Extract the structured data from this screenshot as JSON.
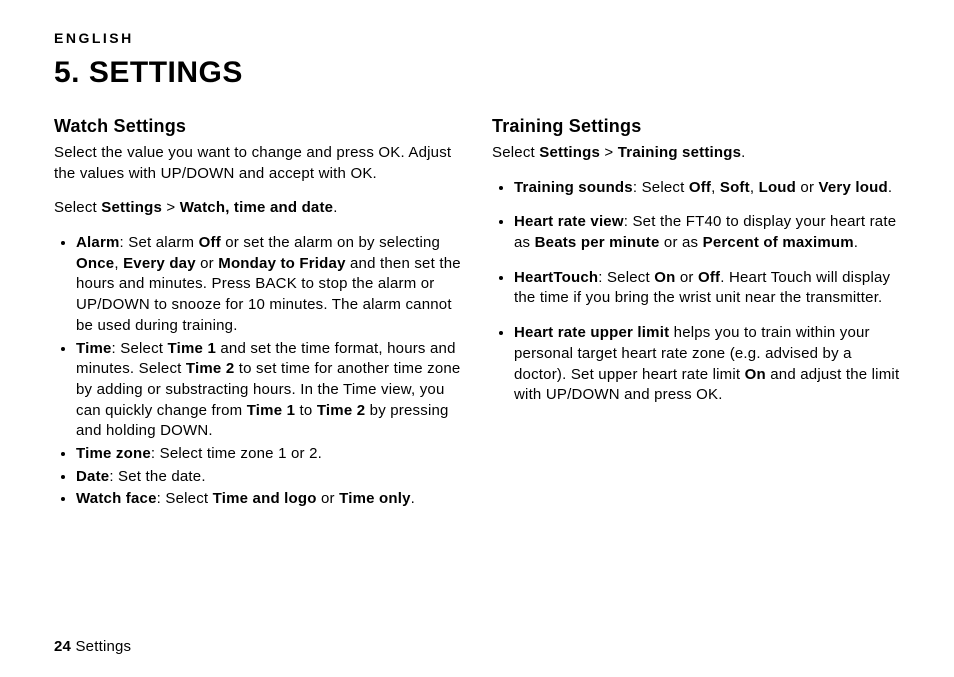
{
  "header": {
    "language": "ENGLISH",
    "title": "5. SETTINGS"
  },
  "watch": {
    "heading": "Watch Settings",
    "intro": "Select the value you want to change and press OK. Adjust the values with UP/DOWN and accept with OK.",
    "select_pre": "Select ",
    "select_path_a": "Settings",
    "select_gt": " > ",
    "select_path_b": "Watch, time and date",
    "select_post": ".",
    "alarm": {
      "label": "Alarm",
      "t1": ": Set alarm ",
      "off": "Off",
      "t2": " or set the alarm on by selecting ",
      "once": "Once",
      "t3": ", ",
      "everyday": "Every day",
      "t4": " or ",
      "mon_fri": "Monday to Friday",
      "t5": " and then set the hours and minutes. Press BACK to stop the alarm or UP/DOWN to snooze for 10 minutes. The alarm cannot be used during training."
    },
    "time": {
      "label": "Time",
      "t1": ": Select ",
      "time1a": "Time 1",
      "t2": " and set the time format, hours and minutes. Select ",
      "time2a": "Time 2",
      "t3": " to set time for another time zone by adding or substracting hours. In the Time view, you can quickly change from ",
      "time1b": "Time 1",
      "t4": " to ",
      "time2b": "Time 2",
      "t5": " by pressing and holding DOWN."
    },
    "zone": {
      "label": "Time zone",
      "text": ": Select time zone 1 or 2."
    },
    "date": {
      "label": "Date",
      "text": ": Set the date."
    },
    "face": {
      "label": "Watch face",
      "t1": ": Select ",
      "opt1": "Time and logo",
      "t2": " or ",
      "opt2": "Time only",
      "t3": "."
    }
  },
  "training": {
    "heading": "Training Settings",
    "select_pre": "Select ",
    "select_path_a": "Settings",
    "select_gt": " > ",
    "select_path_b": "Training settings",
    "select_post": ".",
    "sounds": {
      "label": "Training sounds",
      "t1": ": Select ",
      "off": "Off",
      "t2": ", ",
      "soft": "Soft",
      "t3": ", ",
      "loud": "Loud",
      "t4": " or ",
      "vloud": "Very loud",
      "t5": "."
    },
    "hrview": {
      "label": "Heart rate view",
      "t1": ": Set the FT40 to display your heart rate as ",
      "bpm": "Beats per minute",
      "t2": " or as ",
      "pct": "Percent of maximum",
      "t3": "."
    },
    "htouch": {
      "label": "HeartTouch",
      "t1": ": Select ",
      "on": "On",
      "t2": " or ",
      "off": "Off",
      "t3": ". Heart Touch will display the time if you bring the wrist unit near the transmitter."
    },
    "hrlimit": {
      "label": "Heart rate upper limit",
      "t1": " helps you to train within your personal target heart rate zone (e.g. advised by a doctor). Set upper heart rate limit ",
      "on": "On",
      "t2": " and adjust the limit with UP/DOWN and press OK."
    }
  },
  "footer": {
    "page_no": "24",
    "section": " Settings"
  }
}
